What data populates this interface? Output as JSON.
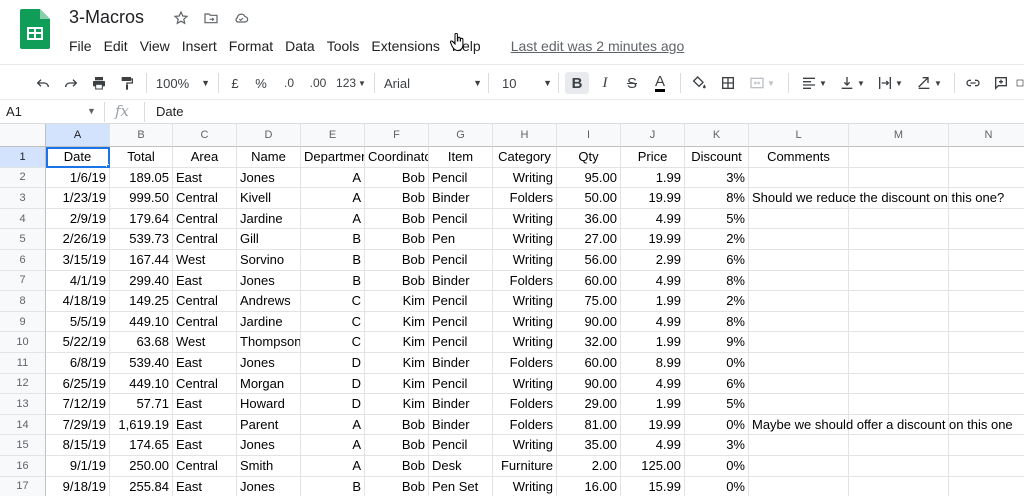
{
  "doc": {
    "title": "3-Macros",
    "last_edit": "Last edit was 2 minutes ago"
  },
  "icons": [
    "star-icon",
    "move-to-folder-icon",
    "cloud-status-icon"
  ],
  "menu": [
    "File",
    "Edit",
    "View",
    "Insert",
    "Format",
    "Data",
    "Tools",
    "Extensions",
    "Help"
  ],
  "toolbar": {
    "zoom": "100%",
    "currency": "£",
    "percent": "%",
    "decrease_decimal": ".0",
    "increase_decimal": ".00",
    "more_formats": "123",
    "font": "Arial",
    "font_size": "10",
    "bold": "B",
    "italic": "I",
    "strike": "S",
    "text_color": "A"
  },
  "formula_bar": {
    "cell_ref": "A1",
    "fx": "fx",
    "value": "Date"
  },
  "grid": {
    "columns": [
      "A",
      "B",
      "C",
      "D",
      "E",
      "F",
      "G",
      "H",
      "I",
      "J",
      "K",
      "L",
      "M",
      "N"
    ],
    "row_numbers": [
      "1",
      "2",
      "3",
      "4",
      "5",
      "6",
      "7",
      "8",
      "9",
      "10",
      "11",
      "12",
      "13",
      "14",
      "15",
      "16",
      "17"
    ],
    "rows": [
      [
        "Date",
        "Total",
        "Area",
        "Name",
        "Department",
        "Coordinator",
        "Item",
        "Category",
        "Qty",
        "Price",
        "Discount",
        "Comments",
        "",
        ""
      ],
      [
        "1/6/19",
        "189.05",
        "East",
        "Jones",
        "A",
        "Bob",
        "Pencil",
        "Writing",
        "95.00",
        "1.99",
        "3%",
        "",
        "",
        ""
      ],
      [
        "1/23/19",
        "999.50",
        "Central",
        "Kivell",
        "A",
        "Bob",
        "Binder",
        "Folders",
        "50.00",
        "19.99",
        "8%",
        "Should we reduce the discount on this one?",
        "",
        ""
      ],
      [
        "2/9/19",
        "179.64",
        "Central",
        "Jardine",
        "A",
        "Bob",
        "Pencil",
        "Writing",
        "36.00",
        "4.99",
        "5%",
        "",
        "",
        ""
      ],
      [
        "2/26/19",
        "539.73",
        "Central",
        "Gill",
        "B",
        "Bob",
        "Pen",
        "Writing",
        "27.00",
        "19.99",
        "2%",
        "",
        "",
        ""
      ],
      [
        "3/15/19",
        "167.44",
        "West",
        "Sorvino",
        "B",
        "Bob",
        "Pencil",
        "Writing",
        "56.00",
        "2.99",
        "6%",
        "",
        "",
        ""
      ],
      [
        "4/1/19",
        "299.40",
        "East",
        "Jones",
        "B",
        "Bob",
        "Binder",
        "Folders",
        "60.00",
        "4.99",
        "8%",
        "",
        "",
        ""
      ],
      [
        "4/18/19",
        "149.25",
        "Central",
        "Andrews",
        "C",
        "Kim",
        "Pencil",
        "Writing",
        "75.00",
        "1.99",
        "2%",
        "",
        "",
        ""
      ],
      [
        "5/5/19",
        "449.10",
        "Central",
        "Jardine",
        "C",
        "Kim",
        "Pencil",
        "Writing",
        "90.00",
        "4.99",
        "8%",
        "",
        "",
        ""
      ],
      [
        "5/22/19",
        "63.68",
        "West",
        "Thompson",
        "C",
        "Kim",
        "Pencil",
        "Writing",
        "32.00",
        "1.99",
        "9%",
        "",
        "",
        ""
      ],
      [
        "6/8/19",
        "539.40",
        "East",
        "Jones",
        "D",
        "Kim",
        "Binder",
        "Folders",
        "60.00",
        "8.99",
        "0%",
        "",
        "",
        ""
      ],
      [
        "6/25/19",
        "449.10",
        "Central",
        "Morgan",
        "D",
        "Kim",
        "Pencil",
        "Writing",
        "90.00",
        "4.99",
        "6%",
        "",
        "",
        ""
      ],
      [
        "7/12/19",
        "57.71",
        "East",
        "Howard",
        "D",
        "Kim",
        "Binder",
        "Folders",
        "29.00",
        "1.99",
        "5%",
        "",
        "",
        ""
      ],
      [
        "7/29/19",
        "1,619.19",
        "East",
        "Parent",
        "A",
        "Bob",
        "Binder",
        "Folders",
        "81.00",
        "19.99",
        "0%",
        "Maybe we should offer a discount on this one",
        "",
        ""
      ],
      [
        "8/15/19",
        "174.65",
        "East",
        "Jones",
        "A",
        "Bob",
        "Pencil",
        "Writing",
        "35.00",
        "4.99",
        "3%",
        "",
        "",
        ""
      ],
      [
        "9/1/19",
        "250.00",
        "Central",
        "Smith",
        "A",
        "Bob",
        "Desk",
        "Furniture",
        "2.00",
        "125.00",
        "0%",
        "",
        "",
        ""
      ],
      [
        "9/18/19",
        "255.84",
        "East",
        "Jones",
        "B",
        "Bob",
        "Pen Set",
        "Writing",
        "16.00",
        "15.99",
        "0%",
        "",
        "",
        ""
      ]
    ]
  },
  "colors": {
    "sheets_green": "#0f9d58",
    "selection_blue": "#1a73e8",
    "header_bg": "#f8f9fa"
  }
}
